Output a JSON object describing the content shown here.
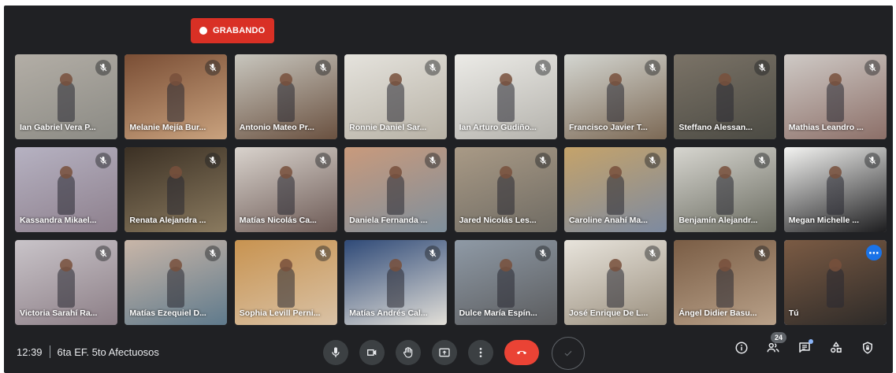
{
  "recording": {
    "label": "GRABANDO",
    "color": "#d93025"
  },
  "participants": [
    {
      "name": "Ian Gabriel Vera P...",
      "muted": true,
      "bg": [
        "#b3aea6",
        "#8b8a84"
      ]
    },
    {
      "name": "Melanie Mejía Bur...",
      "muted": true,
      "bg": [
        "#7a4e35",
        "#c9a27e"
      ]
    },
    {
      "name": "Antonio Mateo Pr...",
      "muted": true,
      "bg": [
        "#c8c6be",
        "#6a5140"
      ]
    },
    {
      "name": "Ronnie Daniel Sar...",
      "muted": true,
      "bg": [
        "#e5e3dd",
        "#b7b1a5"
      ]
    },
    {
      "name": "Ian Arturo Gudiño...",
      "muted": true,
      "bg": [
        "#ecebe7",
        "#b4b2ac"
      ]
    },
    {
      "name": "Francisco Javier T...",
      "muted": true,
      "bg": [
        "#d4d6d1",
        "#7c6955"
      ]
    },
    {
      "name": "Steffano Alessan...",
      "muted": true,
      "bg": [
        "#7b7367",
        "#4b4a43"
      ]
    },
    {
      "name": "Mathias Leandro ...",
      "muted": true,
      "bg": [
        "#cfcac6",
        "#8c6f68"
      ]
    },
    {
      "name": "Kassandra Mikael...",
      "muted": true,
      "bg": [
        "#b6b2c2",
        "#8d7f8c"
      ]
    },
    {
      "name": "Renata Alejandra ...",
      "muted": true,
      "bg": [
        "#3b3024",
        "#8a7a5f"
      ]
    },
    {
      "name": "Matías Nicolás Ca...",
      "muted": true,
      "bg": [
        "#d9d3cd",
        "#6d5a55"
      ]
    },
    {
      "name": "Daniela Fernanda ...",
      "muted": true,
      "bg": [
        "#c99a7c",
        "#7f8f9c"
      ]
    },
    {
      "name": "Jared Nicolás Les...",
      "muted": true,
      "bg": [
        "#a99a86",
        "#6f6b63"
      ]
    },
    {
      "name": "Caroline Anahí Ma...",
      "muted": true,
      "bg": [
        "#c5a36a",
        "#7d8aa0"
      ]
    },
    {
      "name": "Benjamín Alejandr...",
      "muted": true,
      "bg": [
        "#d7d6d0",
        "#6a6b60"
      ]
    },
    {
      "name": "Megan Michelle ...",
      "muted": true,
      "bg": [
        "#f4f4f2",
        "#1d1d1f"
      ]
    },
    {
      "name": "Victoria Sarahí Ra...",
      "muted": true,
      "bg": [
        "#c9c4c9",
        "#8c7e86"
      ]
    },
    {
      "name": "Matías Ezequiel D...",
      "muted": true,
      "bg": [
        "#c9b6a8",
        "#5f7a8c"
      ]
    },
    {
      "name": "Sophia Levill Perni...",
      "muted": true,
      "bg": [
        "#c89350",
        "#d9c2a6"
      ]
    },
    {
      "name": "Matías Andrés Cal...",
      "muted": true,
      "bg": [
        "#2f4a78",
        "#e2dfd8"
      ]
    },
    {
      "name": "Dulce María Espín...",
      "muted": true,
      "bg": [
        "#8f9aa6",
        "#5b5c5e"
      ]
    },
    {
      "name": "José Enrique De L...",
      "muted": true,
      "bg": [
        "#e8e4dc",
        "#9a8f7e"
      ]
    },
    {
      "name": "Ángel Didier Basu...",
      "muted": true,
      "bg": [
        "#7a5d45",
        "#b9a189"
      ]
    },
    {
      "name": "Tú",
      "muted": false,
      "self": true,
      "bg": [
        "#7b5b44",
        "#2d2a28"
      ]
    }
  ],
  "meeting": {
    "time": "12:39",
    "title": "6ta EF. 5to Afectuosos"
  },
  "controls": {
    "mic_icon": "microphone-icon",
    "camera_icon": "camera-icon",
    "hand_icon": "raise-hand-icon",
    "present_icon": "present-screen-icon",
    "more_icon": "more-options-icon",
    "hangup_icon": "hang-up-icon",
    "hangup_color": "#ea4335"
  },
  "right_panel": {
    "participants_count": "24"
  }
}
